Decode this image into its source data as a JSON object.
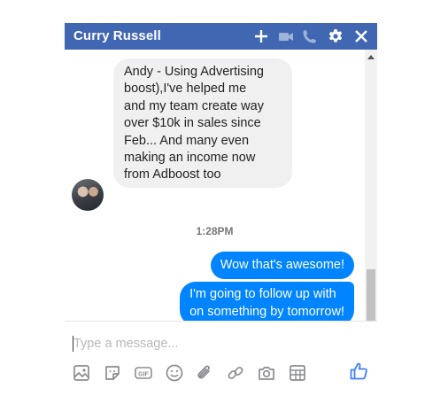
{
  "header": {
    "title": "Curry Russell",
    "icons": [
      "plus-icon",
      "video-icon",
      "phone-icon",
      "gear-icon",
      "close-icon"
    ],
    "color": "#4267b2"
  },
  "messages": {
    "incoming": {
      "lines": [
        "Andy - Using Advertising",
        "boost),I've helped me",
        "and my team create way",
        "over $10k in sales since",
        "Feb...  And many even",
        "making an income now",
        "from Adboost too"
      ]
    },
    "timestamp": "1:28PM",
    "outgoing": [
      {
        "lines": [
          "Wow that's awesome!"
        ]
      },
      {
        "lines": [
          "I'm going to follow up with",
          "on something by tomorrow!"
        ]
      }
    ],
    "outgoing_color": "#0084ff",
    "incoming_color": "#f1f0f0"
  },
  "composer": {
    "placeholder": "Type a message...",
    "tools": [
      "image-icon",
      "sticker-icon",
      "gif-icon",
      "emoji-icon",
      "attachment-icon",
      "link-icon",
      "camera-icon",
      "table-icon"
    ],
    "send_icon": "thumbs-up-icon"
  }
}
